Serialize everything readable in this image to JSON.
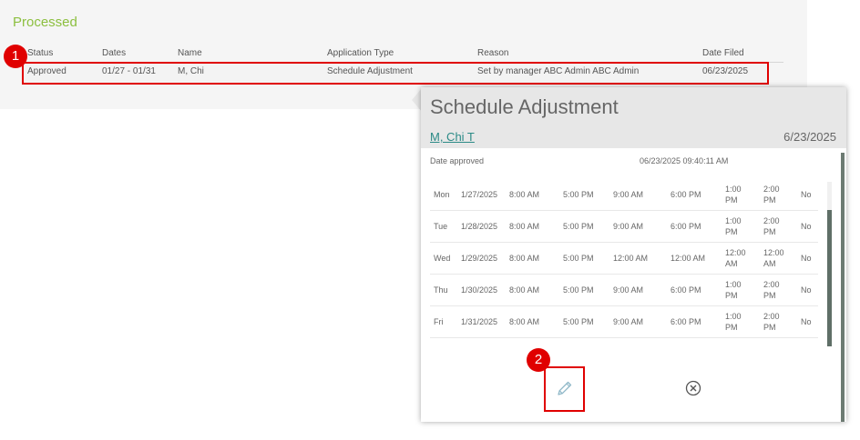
{
  "section": {
    "title": "Processed"
  },
  "table": {
    "headers": [
      "Status",
      "Dates",
      "Name",
      "Application Type",
      "Reason",
      "Date Filed"
    ],
    "row": [
      "Approved",
      "01/27 - 01/31",
      "M, Chi",
      "Schedule Adjustment",
      "Set by manager ABC Admin ABC Admin",
      "06/23/2025"
    ]
  },
  "markers": {
    "one": "1",
    "two": "2"
  },
  "popup": {
    "title": "Schedule Adjustment",
    "employee": "M, Chi T",
    "date": "6/23/2025",
    "approved_label": "Date approved",
    "approved_value": "06/23/2025 09:40:11 AM",
    "schedule": [
      {
        "day": "Mon",
        "date": "1/27/2025",
        "in": "8:00 AM",
        "out": "5:00 PM",
        "new_in": "9:00 AM",
        "new_out": "6:00 PM",
        "b1a": "1:00",
        "b1b": "PM",
        "b2a": "2:00",
        "b2b": "PM",
        "flag": "No"
      },
      {
        "day": "Tue",
        "date": "1/28/2025",
        "in": "8:00 AM",
        "out": "5:00 PM",
        "new_in": "9:00 AM",
        "new_out": "6:00 PM",
        "b1a": "1:00",
        "b1b": "PM",
        "b2a": "2:00",
        "b2b": "PM",
        "flag": "No"
      },
      {
        "day": "Wed",
        "date": "1/29/2025",
        "in": "8:00 AM",
        "out": "5:00 PM",
        "new_in": "12:00 AM",
        "new_out": "12:00 AM",
        "b1a": "12:00",
        "b1b": "AM",
        "b2a": "12:00",
        "b2b": "AM",
        "flag": "No"
      },
      {
        "day": "Thu",
        "date": "1/30/2025",
        "in": "8:00 AM",
        "out": "5:00 PM",
        "new_in": "9:00 AM",
        "new_out": "6:00 PM",
        "b1a": "1:00",
        "b1b": "PM",
        "b2a": "2:00",
        "b2b": "PM",
        "flag": "No"
      },
      {
        "day": "Fri",
        "date": "1/31/2025",
        "in": "8:00 AM",
        "out": "5:00 PM",
        "new_in": "9:00 AM",
        "new_out": "6:00 PM",
        "b1a": "1:00",
        "b1b": "PM",
        "b2a": "2:00",
        "b2b": "PM",
        "flag": "No"
      }
    ]
  },
  "icons": {
    "edit": "pencil-icon",
    "close": "circle-x-icon"
  },
  "colors": {
    "accent_green": "#8cbf3f",
    "highlight_red": "#e00000",
    "link_teal": "#2a8a86"
  }
}
